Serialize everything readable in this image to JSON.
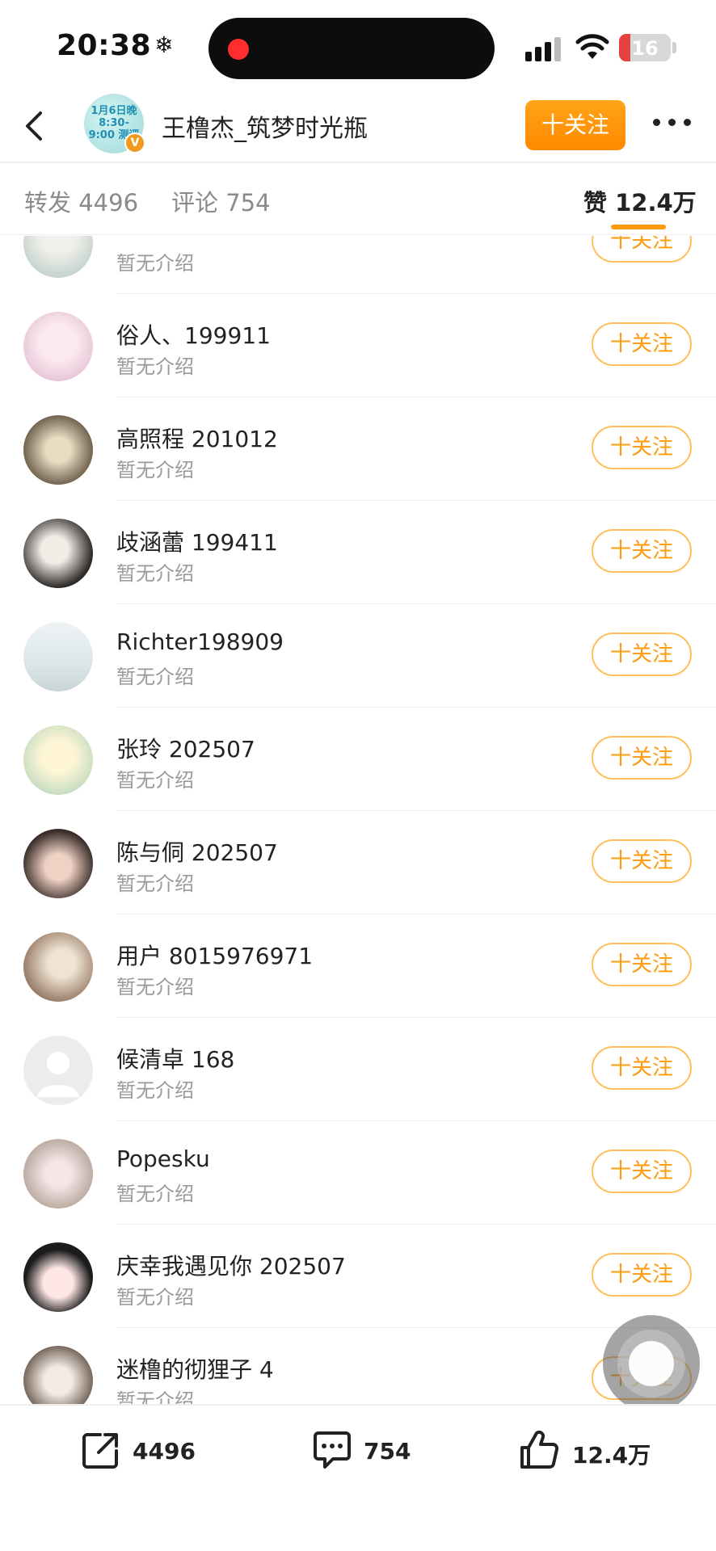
{
  "status_bar": {
    "time": "20:38",
    "time_icon": "❄",
    "battery": "16"
  },
  "header": {
    "title": "王橹杰_筑梦时光瓶",
    "avatar_text": "1月6日晚 8:30-9:00 测评",
    "follow_label": "十关注"
  },
  "tabs": {
    "repost": "转发 4496",
    "comment": "评论 754",
    "like": "赞 12.4万"
  },
  "list": {
    "follow_label": "十关注",
    "items": [
      {
        "name": "",
        "intro": "暂无介绍"
      },
      {
        "name": "俗人、199911",
        "intro": "暂无介绍"
      },
      {
        "name": "高照程 201012",
        "intro": "暂无介绍"
      },
      {
        "name": "歧涵蕾 199411",
        "intro": "暂无介绍"
      },
      {
        "name": "Richter198909",
        "intro": "暂无介绍"
      },
      {
        "name": "张玲 202507",
        "intro": "暂无介绍"
      },
      {
        "name": "陈与侗 202507",
        "intro": "暂无介绍"
      },
      {
        "name": "用户 8015976971",
        "intro": "暂无介绍"
      },
      {
        "name": "候清卓 168",
        "intro": "暂无介绍"
      },
      {
        "name": "Popesku",
        "intro": "暂无介绍"
      },
      {
        "name": "庆幸我遇见你 202507",
        "intro": "暂无介绍"
      },
      {
        "name": "迷橹的彻狸子 4",
        "intro": "暂无介绍"
      }
    ]
  },
  "bottom_bar": {
    "repost": "4496",
    "comment": "754",
    "like": "12.4万"
  },
  "colors": {
    "accent": "#ff9a0c",
    "follow_border": "#ffbf5a",
    "muted": "#9a9a9a"
  }
}
